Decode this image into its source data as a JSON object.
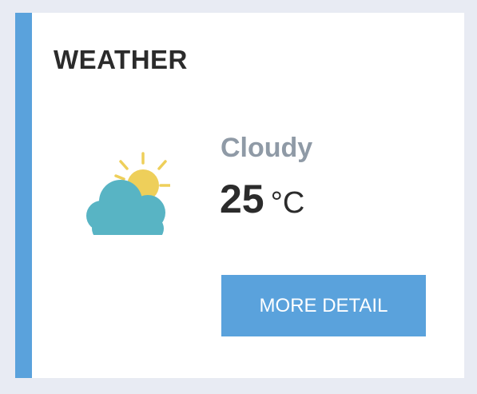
{
  "widget": {
    "title": "WEATHER",
    "condition": "Cloudy",
    "temperature": "25",
    "unit": "°C",
    "icon": "partly-cloudy-icon",
    "button_label": "MORE DETAIL"
  },
  "colors": {
    "accent": "#5aa2dc",
    "cloud": "#58b4c4",
    "sun": "#eecf5a",
    "condition_text": "#8f9aa6",
    "title_text": "#2b2b2b",
    "page_background": "#e8ebf3"
  }
}
